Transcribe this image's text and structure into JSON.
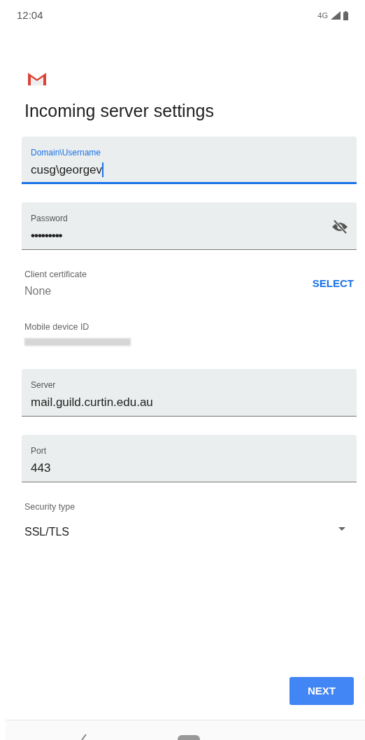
{
  "status_bar": {
    "time": "12:04",
    "network": "4G"
  },
  "title": "Incoming server settings",
  "fields": [
    {
      "kind": "input",
      "label": "Domain\\Username",
      "value": "cusg\\georgev",
      "focused": true
    },
    {
      "kind": "password",
      "label": "Password",
      "value": "•••••••••",
      "focused": false
    },
    {
      "kind": "certificate",
      "label": "Client certificate",
      "value": "None",
      "action": "SELECT"
    },
    {
      "kind": "redacted",
      "label": "Mobile device ID"
    },
    {
      "kind": "input",
      "label": "Server",
      "value": "mail.guild.curtin.edu.au",
      "focused": false
    },
    {
      "kind": "input",
      "label": "Port",
      "value": "443",
      "focused": false
    },
    {
      "kind": "dropdown",
      "label": "Security type",
      "value": "SSL/TLS"
    }
  ],
  "next_button": "NEXT"
}
